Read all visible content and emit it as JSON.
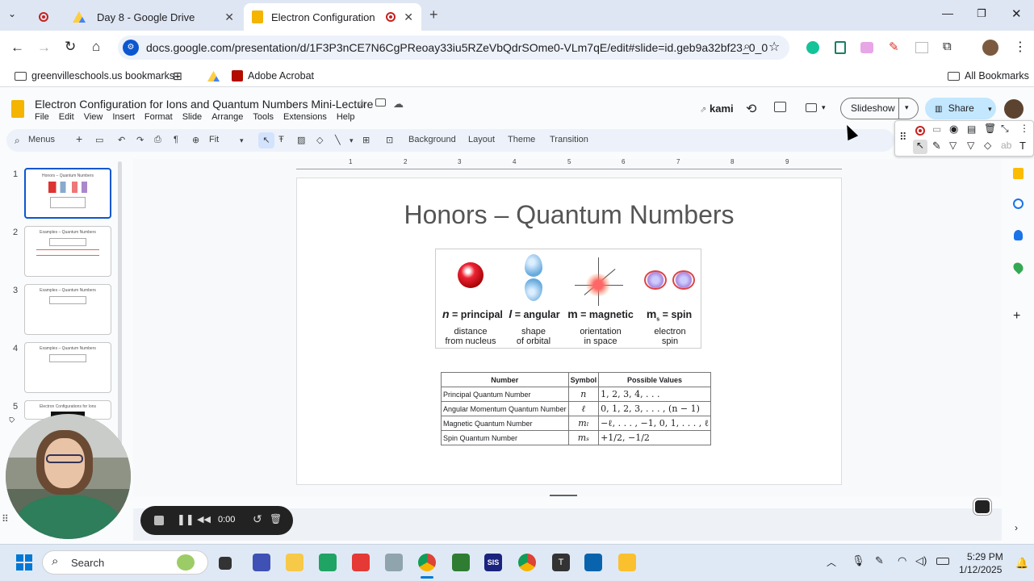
{
  "browser": {
    "tabs": [
      {
        "label": ""
      },
      {
        "label": "Day 8 - Google Drive"
      },
      {
        "label": "Electron Configuration for I"
      }
    ],
    "url": "docs.google.com/presentation/d/1F3P3nCE7N6CgPReoay33iu5RZeVbQdrSOme0-VLm7qE/edit#slide=id.geb9a32bf23_0_0",
    "bookmarks": [
      {
        "label": "greenvilleschools.us bookmarks"
      },
      {
        "label": "Adobe Acrobat"
      }
    ],
    "all_bookmarks": "All Bookmarks"
  },
  "docs": {
    "title": "Electron Configuration for Ions and Quantum Numbers Mini-Lecture",
    "menu": [
      "File",
      "Edit",
      "View",
      "Insert",
      "Format",
      "Slide",
      "Arrange",
      "Tools",
      "Extensions",
      "Help"
    ],
    "kami": "kami",
    "slideshow": "Slideshow",
    "share": "Share",
    "toolbar": {
      "menus": "Menus",
      "zoom": "Fit",
      "background": "Background",
      "layout": "Layout",
      "theme": "Theme",
      "transition": "Transition"
    }
  },
  "filmstrip": [
    {
      "num": "1",
      "title": "Honors – Quantum Numbers"
    },
    {
      "num": "2",
      "title": "Examples – Quantum Numbers"
    },
    {
      "num": "3",
      "title": "Examples – Quantum Numbers"
    },
    {
      "num": "4",
      "title": "Examples – Quantum Numbers"
    },
    {
      "num": "5",
      "title": "Electron Configurations for Ions"
    }
  ],
  "ruler": [
    "1",
    "2",
    "3",
    "4",
    "5",
    "6",
    "7",
    "8",
    "9"
  ],
  "slide": {
    "title": "Honors – Quantum Numbers",
    "quantum": [
      {
        "sym": "n",
        "label": " = principal",
        "desc1": "distance",
        "desc2": "from nucleus"
      },
      {
        "sym": "l",
        "label": " = angular",
        "desc1": "shape",
        "desc2": "of orbital"
      },
      {
        "sym": "m",
        "label": " = magnetic",
        "desc1": "orientation",
        "desc2": "in space"
      },
      {
        "sym": "m",
        "label": " = spin",
        "desc1": "electron",
        "desc2": "spin"
      }
    ],
    "table": {
      "headers": [
        "Number",
        "Symbol",
        "Possible Values"
      ],
      "rows": [
        [
          "Principal Quantum Number",
          "n",
          "1, 2, 3, 4, . . ."
        ],
        [
          "Angular Momentum Quantum Number",
          "ℓ",
          "0, 1, 2, 3, . . . , (n − 1)"
        ],
        [
          "Magnetic Quantum Number",
          "mₗ",
          "−ℓ, . . . , −1, 0, 1, . . . , ℓ"
        ],
        [
          "Spin Quantum Number",
          "mₛ",
          "+1/2, −1/2"
        ]
      ]
    }
  },
  "recorder": {
    "time": "0:00"
  },
  "taskbar": {
    "search": "Search",
    "time": "5:29 PM",
    "date": "1/12/2025"
  },
  "colors": {
    "accent": "#0b57d0",
    "record": "#c5221f",
    "share_bg": "#c2e7ff"
  }
}
